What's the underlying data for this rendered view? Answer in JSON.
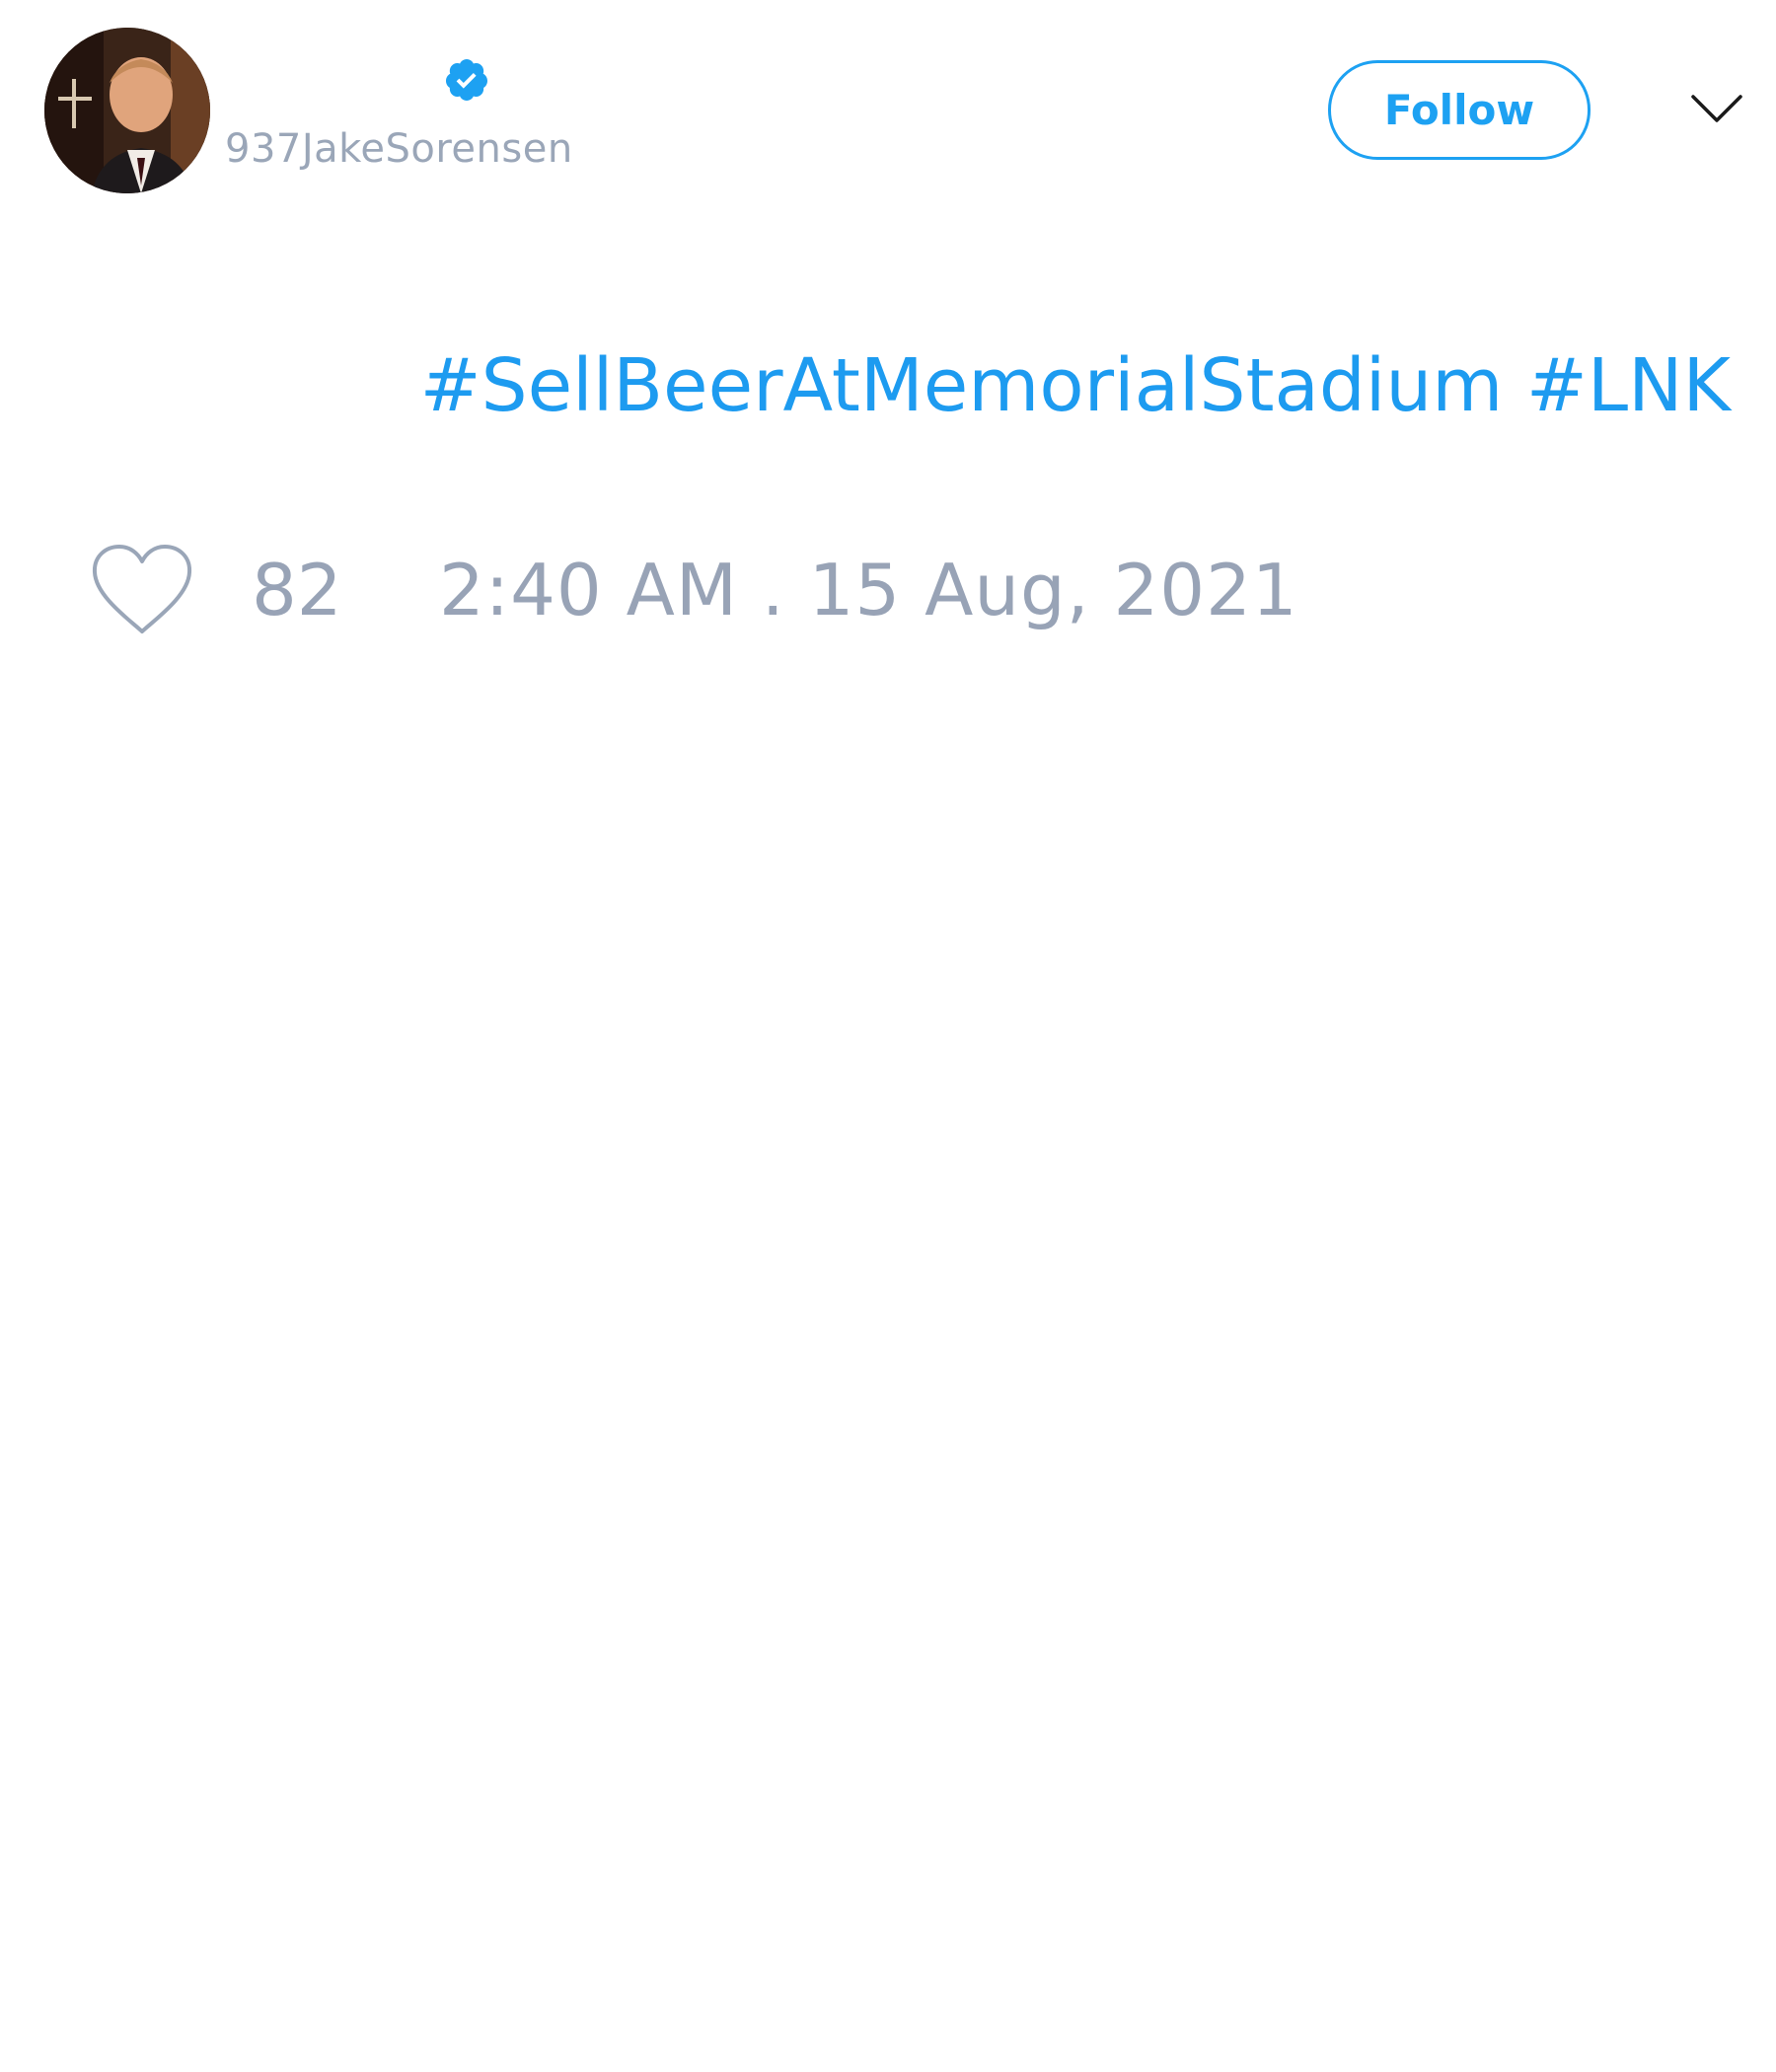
{
  "author": {
    "display_name": "",
    "handle": "937JakeSorensen",
    "verified": true
  },
  "actions": {
    "follow_label": "Follow"
  },
  "tweet": {
    "hashtags": [
      "#SellBeerAtMemorialStadium",
      "#LNK"
    ]
  },
  "footer": {
    "like_count": "82",
    "timestamp": "2:40 AM . 15 Aug, 2021"
  },
  "icons": {
    "verified": "verified-badge-icon",
    "caret": "chevron-down-icon",
    "like": "heart-icon"
  },
  "colors": {
    "accent": "#1da1f2",
    "muted_text": "#98a3b6",
    "background": "#ffffff"
  }
}
